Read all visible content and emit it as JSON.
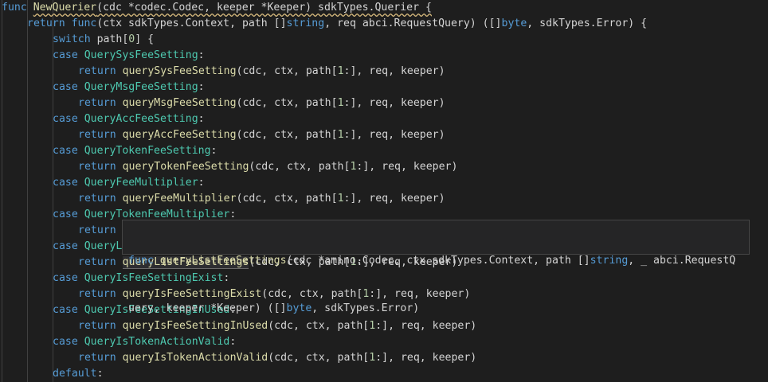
{
  "editor": {
    "lines": [
      {
        "indent": 0,
        "tokens": [
          [
            "kw",
            "func"
          ],
          [
            "pl",
            " "
          ],
          [
            "fn",
            "NewQuerier",
            "squiggle"
          ],
          [
            "pl",
            "(cdc *codec.Codec, keeper *Keeper) sdkTypes.Querier {",
            "squiggle"
          ]
        ]
      },
      {
        "indent": 1,
        "tokens": [
          [
            "kw",
            "return"
          ],
          [
            "pl",
            " "
          ],
          [
            "kw",
            "func"
          ],
          [
            "pl",
            "(ctx sdkTypes.Context, path []"
          ],
          [
            "kw",
            "string"
          ],
          [
            "pl",
            ", req abci.RequestQuery) ([]"
          ],
          [
            "kw",
            "byte"
          ],
          [
            "pl",
            ", sdkTypes.Error) {"
          ]
        ]
      },
      {
        "indent": 2,
        "tokens": [
          [
            "kw",
            "switch"
          ],
          [
            "pl",
            " path["
          ],
          [
            "nm",
            "0"
          ],
          [
            "pl",
            "] {"
          ]
        ]
      },
      {
        "indent": 2,
        "tokens": [
          [
            "kw",
            "case"
          ],
          [
            "pl",
            " "
          ],
          [
            "ty",
            "QuerySysFeeSetting"
          ],
          [
            "pl",
            ":"
          ]
        ]
      },
      {
        "indent": 3,
        "tokens": [
          [
            "kw",
            "return"
          ],
          [
            "pl",
            " "
          ],
          [
            "fn",
            "querySysFeeSetting"
          ],
          [
            "pl",
            "(cdc, ctx, path["
          ],
          [
            "nm",
            "1"
          ],
          [
            "pl",
            ":], req, keeper)"
          ]
        ]
      },
      {
        "indent": 2,
        "tokens": [
          [
            "kw",
            "case"
          ],
          [
            "pl",
            " "
          ],
          [
            "ty",
            "QueryMsgFeeSetting"
          ],
          [
            "pl",
            ":"
          ]
        ]
      },
      {
        "indent": 3,
        "tokens": [
          [
            "kw",
            "return"
          ],
          [
            "pl",
            " "
          ],
          [
            "fn",
            "queryMsgFeeSetting"
          ],
          [
            "pl",
            "(cdc, ctx, path["
          ],
          [
            "nm",
            "1"
          ],
          [
            "pl",
            ":], req, keeper)"
          ]
        ]
      },
      {
        "indent": 2,
        "tokens": [
          [
            "kw",
            "case"
          ],
          [
            "pl",
            " "
          ],
          [
            "ty",
            "QueryAccFeeSetting"
          ],
          [
            "pl",
            ":"
          ]
        ]
      },
      {
        "indent": 3,
        "tokens": [
          [
            "kw",
            "return"
          ],
          [
            "pl",
            " "
          ],
          [
            "fn",
            "queryAccFeeSetting"
          ],
          [
            "pl",
            "(cdc, ctx, path["
          ],
          [
            "nm",
            "1"
          ],
          [
            "pl",
            ":], req, keeper)"
          ]
        ]
      },
      {
        "indent": 2,
        "tokens": [
          [
            "kw",
            "case"
          ],
          [
            "pl",
            " "
          ],
          [
            "ty",
            "QueryTokenFeeSetting"
          ],
          [
            "pl",
            ":"
          ]
        ]
      },
      {
        "indent": 3,
        "tokens": [
          [
            "kw",
            "return"
          ],
          [
            "pl",
            " "
          ],
          [
            "fn",
            "queryTokenFeeSetting"
          ],
          [
            "pl",
            "(cdc, ctx, path["
          ],
          [
            "nm",
            "1"
          ],
          [
            "pl",
            ":], req, keeper)"
          ]
        ]
      },
      {
        "indent": 2,
        "tokens": [
          [
            "kw",
            "case"
          ],
          [
            "pl",
            " "
          ],
          [
            "ty",
            "QueryFeeMultiplier"
          ],
          [
            "pl",
            ":"
          ]
        ]
      },
      {
        "indent": 3,
        "tokens": [
          [
            "kw",
            "return"
          ],
          [
            "pl",
            " "
          ],
          [
            "fn",
            "queryFeeMultiplier"
          ],
          [
            "pl",
            "(cdc, ctx, path["
          ],
          [
            "nm",
            "1"
          ],
          [
            "pl",
            ":], req, keeper)"
          ]
        ]
      },
      {
        "indent": 2,
        "tokens": [
          [
            "kw",
            "case"
          ],
          [
            "pl",
            " "
          ],
          [
            "ty",
            "QueryTokenFeeMultiplier"
          ],
          [
            "pl",
            ":"
          ]
        ]
      },
      {
        "indent": 3,
        "tokens": [
          [
            "kw",
            "return"
          ]
        ]
      },
      {
        "indent": 2,
        "tokens": [
          [
            "kw",
            "case"
          ],
          [
            "pl",
            " "
          ],
          [
            "ty",
            "QueryL"
          ]
        ]
      },
      {
        "indent": 3,
        "tokens": [
          [
            "kw",
            "return"
          ],
          [
            "pl",
            " "
          ],
          [
            "fn",
            "queryListFeeSettings",
            "hl"
          ],
          [
            "pl",
            "(cdc, ctx, path["
          ],
          [
            "nm",
            "1"
          ],
          [
            "pl",
            ":], req, keeper)"
          ]
        ]
      },
      {
        "indent": 2,
        "tokens": [
          [
            "kw",
            "case"
          ],
          [
            "pl",
            " "
          ],
          [
            "ty",
            "QueryIsFeeSettingExist"
          ],
          [
            "pl",
            ":"
          ]
        ]
      },
      {
        "indent": 3,
        "tokens": [
          [
            "kw",
            "return"
          ],
          [
            "pl",
            " "
          ],
          [
            "fn",
            "queryIsFeeSettingExist"
          ],
          [
            "pl",
            "(cdc, ctx, path["
          ],
          [
            "nm",
            "1"
          ],
          [
            "pl",
            ":], req, keeper)"
          ]
        ]
      },
      {
        "indent": 2,
        "tokens": [
          [
            "kw",
            "case"
          ],
          [
            "pl",
            " "
          ],
          [
            "ty",
            "QueryIsFeeSettingInUsed"
          ],
          [
            "pl",
            ":"
          ]
        ]
      },
      {
        "indent": 3,
        "tokens": [
          [
            "kw",
            "return"
          ],
          [
            "pl",
            " "
          ],
          [
            "fn",
            "queryIsFeeSettingInUsed"
          ],
          [
            "pl",
            "(cdc, ctx, path["
          ],
          [
            "nm",
            "1"
          ],
          [
            "pl",
            ":], req, keeper)"
          ]
        ]
      },
      {
        "indent": 2,
        "tokens": [
          [
            "kw",
            "case"
          ],
          [
            "pl",
            " "
          ],
          [
            "ty",
            "QueryIsTokenActionValid"
          ],
          [
            "pl",
            ":"
          ]
        ]
      },
      {
        "indent": 3,
        "tokens": [
          [
            "kw",
            "return"
          ],
          [
            "pl",
            " "
          ],
          [
            "fn",
            "queryIsTokenActionValid"
          ],
          [
            "pl",
            "(cdc, ctx, path["
          ],
          [
            "nm",
            "1"
          ],
          [
            "pl",
            ":], req, keeper)"
          ]
        ]
      },
      {
        "indent": 2,
        "tokens": [
          [
            "kw",
            "default"
          ],
          [
            "pl",
            ":"
          ]
        ]
      }
    ]
  },
  "hover": {
    "line1": [
      [
        "kw",
        "func"
      ],
      [
        "pl",
        " "
      ],
      [
        "fn",
        "queryListFeeSettings"
      ],
      [
        "pl",
        "(cdc *amino.Codec, ctx sdkTypes.Context, path []"
      ],
      [
        "kw",
        "string"
      ],
      [
        "pl",
        ", _ abci.RequestQ"
      ]
    ],
    "line2": [
      [
        "pl",
        "uery, keeper *Keeper) ([]"
      ],
      [
        "kw",
        "byte"
      ],
      [
        "pl",
        ", sdkTypes.Error)"
      ]
    ]
  }
}
